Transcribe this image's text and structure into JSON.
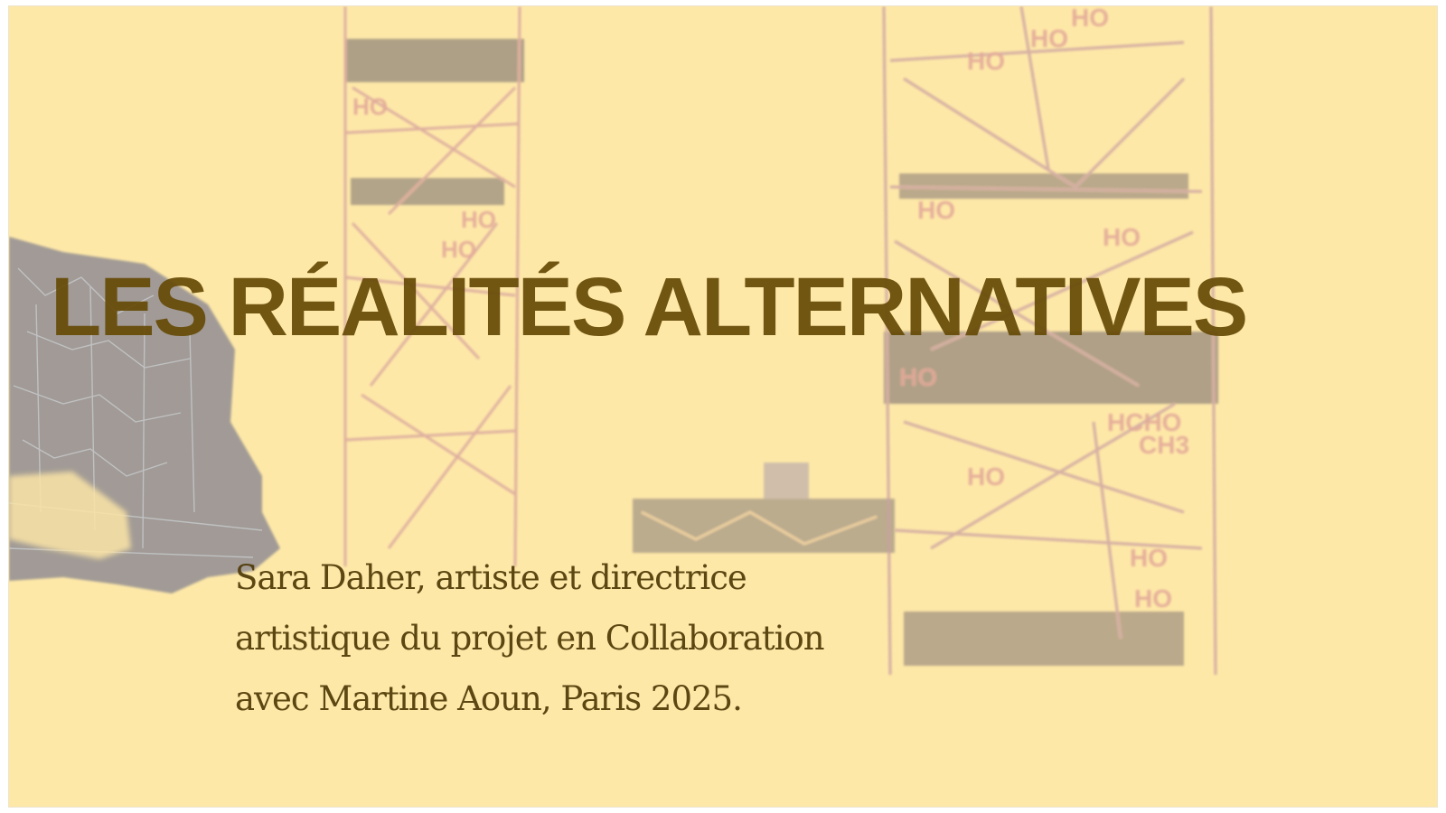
{
  "slide": {
    "title": "LES RÉALITÉS ALTERNATIVES",
    "caption_lines": [
      "Sara  Daher, artiste et directrice",
      "artistique du projet en Collaboration",
      "avec Martine Aoun, Paris 2025."
    ]
  },
  "artwork": {
    "molecule_labels": [
      "HO",
      "HO",
      "HO",
      "HO",
      "HO",
      "HO",
      "HO",
      "HO",
      "HO",
      "HO",
      "HO",
      "HO",
      "HCHO",
      "CH3"
    ]
  },
  "colors": {
    "background": "#fee9a8",
    "title": "#664a06",
    "caption": "#503a06",
    "scaffold_pink": "#c88a9a",
    "scaffold_dark": "#4a3f58",
    "schematic_blue": "#6f7fb2"
  }
}
